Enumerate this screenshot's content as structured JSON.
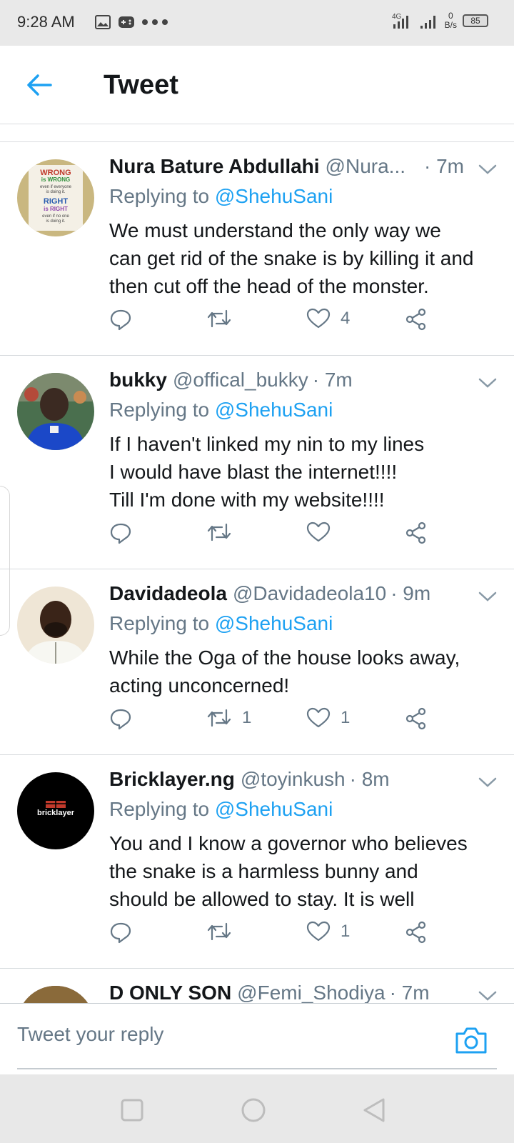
{
  "status_bar": {
    "time": "9:28 AM",
    "network": "4G",
    "net_speed_value": "0",
    "net_speed_unit": "B/s",
    "battery": "85",
    "icons_left": [
      "gallery-icon",
      "game-controller-icon",
      "more-dots-icon"
    ]
  },
  "header": {
    "title": "Tweet",
    "back_icon": "back-arrow-icon"
  },
  "tweets": [
    {
      "display_name": "Nura Bature Abdullahi",
      "handle": "@Nura...",
      "time": "· 7m",
      "replying_label": "Replying to",
      "replying_to": "@ShehuSani",
      "text_lines": [
        "We must understand the only way we",
        "can get rid of the snake is by killing it and",
        "then cut off the head of the monster."
      ],
      "retweets": "",
      "likes": "4",
      "avatar_lines": [
        "WRONG",
        "is WRONG",
        "even if everyone",
        "is doing it.",
        "RIGHT",
        "is RIGHT",
        "even if no one",
        "is doing it."
      ]
    },
    {
      "display_name": "bukky",
      "handle": "@offical_bukky",
      "time": "· 7m",
      "replying_label": "Replying to",
      "replying_to": "@ShehuSani",
      "text_lines": [
        "If I haven't linked my nin to my lines",
        "I would have blast the internet!!!!",
        "Till I'm done with my website!!!!"
      ],
      "retweets": "",
      "likes": ""
    },
    {
      "display_name": "Davidadeola",
      "handle": "@Davidadeola10",
      "time": "· 9m",
      "replying_label": "Replying to",
      "replying_to": "@ShehuSani",
      "text_lines": [
        "While the Oga of the house looks away,",
        "acting unconcerned!"
      ],
      "retweets": "1",
      "likes": "1"
    },
    {
      "display_name": "Bricklayer.ng",
      "handle": "@toyinkush",
      "time": "· 8m",
      "replying_label": "Replying to",
      "replying_to": "@ShehuSani",
      "text_lines": [
        "You and I know a governor who believes",
        "the snake is a harmless bunny and",
        "should be allowed to stay. It is well"
      ],
      "retweets": "",
      "likes": "1",
      "avatar_text": "bricklayer"
    }
  ],
  "partial_tweet": {
    "display_name": "D ONLY SON",
    "handle": "@Femi_Shodiya",
    "time": "· 7m"
  },
  "composer": {
    "placeholder": "Tweet your reply",
    "camera_icon": "camera-icon"
  },
  "nav_bar": [
    "recents-square-icon",
    "home-circle-icon",
    "back-triangle-icon"
  ],
  "colors": {
    "accent": "#1da1f2",
    "secondary_text": "#657786",
    "primary_text": "#14171a"
  }
}
